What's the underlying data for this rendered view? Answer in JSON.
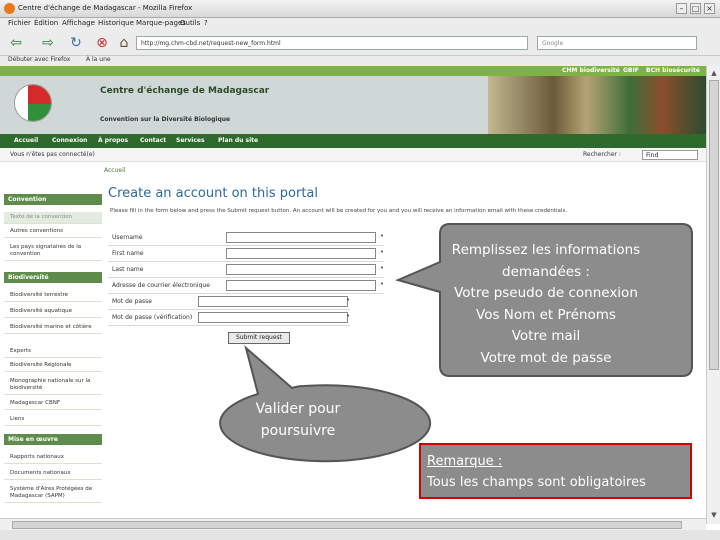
{
  "browser": {
    "title": "Centre d'échange de Madagascar - Mozilla Firefox",
    "menu": [
      "Fichier",
      "Édition",
      "Affichage",
      "Historique",
      "Marque-pages",
      "Outils",
      "?"
    ],
    "url": "http://mg.chm-cbd.net/request-new_form.html",
    "search_placeholder": "Google",
    "bookmarks": [
      "Débuter avec Firefox",
      "À la une"
    ]
  },
  "site": {
    "top_links": [
      "CHM biodiversité",
      "GBIF",
      "BCH biosécurité"
    ],
    "title": "Centre d'échange de Madagascar",
    "subtitle": "Convention sur la Diversité Biologique",
    "nav": [
      "Accueil",
      "Connexion",
      "À propos",
      "Contact",
      "Services",
      "Plan du site"
    ],
    "location_text": "Vous n'êtes pas connecté(e)",
    "search_label": "Rechercher :",
    "search_value": "Find"
  },
  "sidebar": {
    "sections": [
      {
        "title": "Convention",
        "items": [
          "Texte de la convention",
          "Autres conventions",
          "Les pays signataires de la convention"
        ]
      },
      {
        "title": "Biodiversité",
        "items": [
          "Biodiversité terrestre",
          "Biodiversité aquatique",
          "Biodiversité marine et côtière",
          "Experts",
          "Biodiversité Régionale",
          "Monographie nationale sur la biodiversité",
          "Madagascar CBNF",
          "Liens"
        ]
      },
      {
        "title": "Mise en œuvre",
        "items": [
          "Rapports nationaux",
          "Documents nationaux",
          "Système d'Aires Protégées de Madagascar (SAPM)"
        ]
      }
    ]
  },
  "content": {
    "breadcrumb": "Accueil",
    "page_title": "Create an account on this portal",
    "intro": "Please fill in the form below and press the Submit request button. An account will be created for you and you will receive an information email with these credentials.",
    "fields": [
      "Username",
      "First name",
      "Last name",
      "Adresse de courrier électronique",
      "Mot de passe",
      "Mot de passe (vérification)"
    ],
    "submit_label": "Submit request"
  },
  "annotations": {
    "fill_in": [
      "Remplissez les informations",
      "demandées :",
      "Votre pseudo de connexion",
      "Vos Nom et Prénoms",
      "Votre mail",
      "Votre mot de passe"
    ],
    "validate": [
      "Valider pour",
      "poursuivre"
    ],
    "remark_title": "Remarque :",
    "remark_text": "Tous les champs sont obligatoires"
  }
}
